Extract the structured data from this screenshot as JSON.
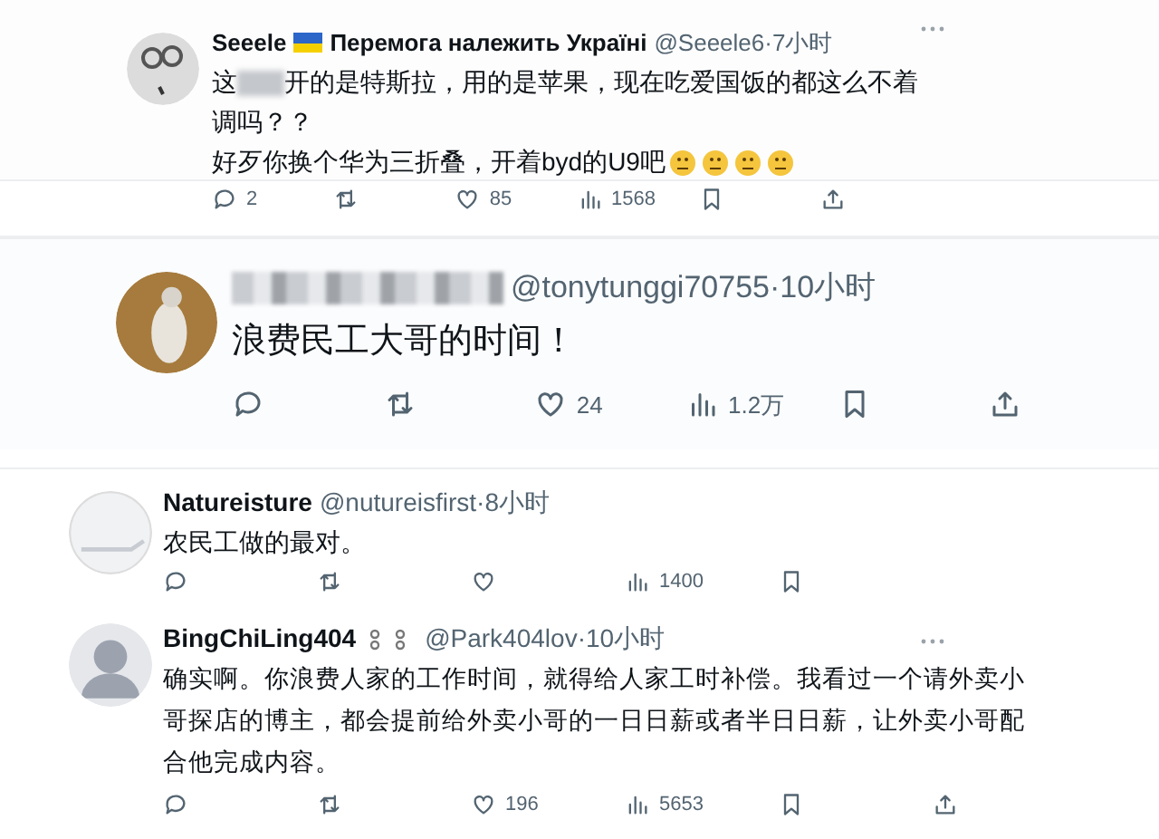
{
  "tweets": [
    {
      "name": "Seeele",
      "flag": true,
      "name_suffix": "Перемога належить Україні",
      "meta": "@Seeele6·7小时",
      "name_blurred": false,
      "more": true,
      "lines": [
        [
          {
            "kind": "text",
            "text": "这"
          },
          {
            "kind": "blur"
          },
          {
            "kind": "text",
            "text": "开的是特斯拉，用的是苹果，现在吃爱国饭的都这么不着调吗？？"
          }
        ],
        [
          {
            "kind": "text",
            "text": "好歹你换个华为三折叠，开着byd的U9吧"
          },
          {
            "kind": "emoji"
          },
          {
            "kind": "emoji"
          },
          {
            "kind": "emoji"
          },
          {
            "kind": "emoji"
          }
        ]
      ],
      "actions": [
        {
          "kind": "reply",
          "count": "2"
        },
        {
          "kind": "retweet"
        },
        {
          "kind": "like",
          "count": "85"
        },
        {
          "kind": "views",
          "count": "1568"
        },
        {
          "kind": "bookmark"
        },
        {
          "kind": "share"
        }
      ]
    },
    {
      "name_blurred": true,
      "meta": "@tonytunggi70755·10小时",
      "more": false,
      "lines": [
        [
          {
            "kind": "text",
            "text": "浪费民工大哥的时间！"
          }
        ]
      ],
      "actions": [
        {
          "kind": "reply"
        },
        {
          "kind": "retweet"
        },
        {
          "kind": "like",
          "count": "24"
        },
        {
          "kind": "views",
          "count": "1.2万"
        },
        {
          "kind": "bookmark"
        },
        {
          "kind": "share"
        }
      ]
    },
    {
      "name": "Natureisture",
      "name_blurred": false,
      "meta": "@nutureisfirst·8小时",
      "more": false,
      "lines": [
        [
          {
            "kind": "text",
            "text": "农民工做的最对。"
          }
        ]
      ],
      "actions": [
        {
          "kind": "reply"
        },
        {
          "kind": "retweet"
        },
        {
          "kind": "like"
        },
        {
          "kind": "views",
          "count": "1400"
        },
        {
          "kind": "bookmark"
        }
      ]
    },
    {
      "name": "BingChiLing404",
      "name_glyphs": true,
      "name_blurred": false,
      "meta": "@Park404lov·10小时",
      "more": true,
      "lines": [
        [
          {
            "kind": "text",
            "text": "确实啊。你浪费人家的工作时间，就得给人家工时补偿。我看过一个请外卖小哥探店的博主，都会提前给外卖小哥的一日日薪或者半日日薪，让外卖小哥配合他完成内容。"
          }
        ]
      ],
      "actions": [
        {
          "kind": "reply"
        },
        {
          "kind": "retweet"
        },
        {
          "kind": "like",
          "count": "196"
        },
        {
          "kind": "views",
          "count": "5653"
        },
        {
          "kind": "bookmark"
        },
        {
          "kind": "share"
        }
      ]
    }
  ]
}
